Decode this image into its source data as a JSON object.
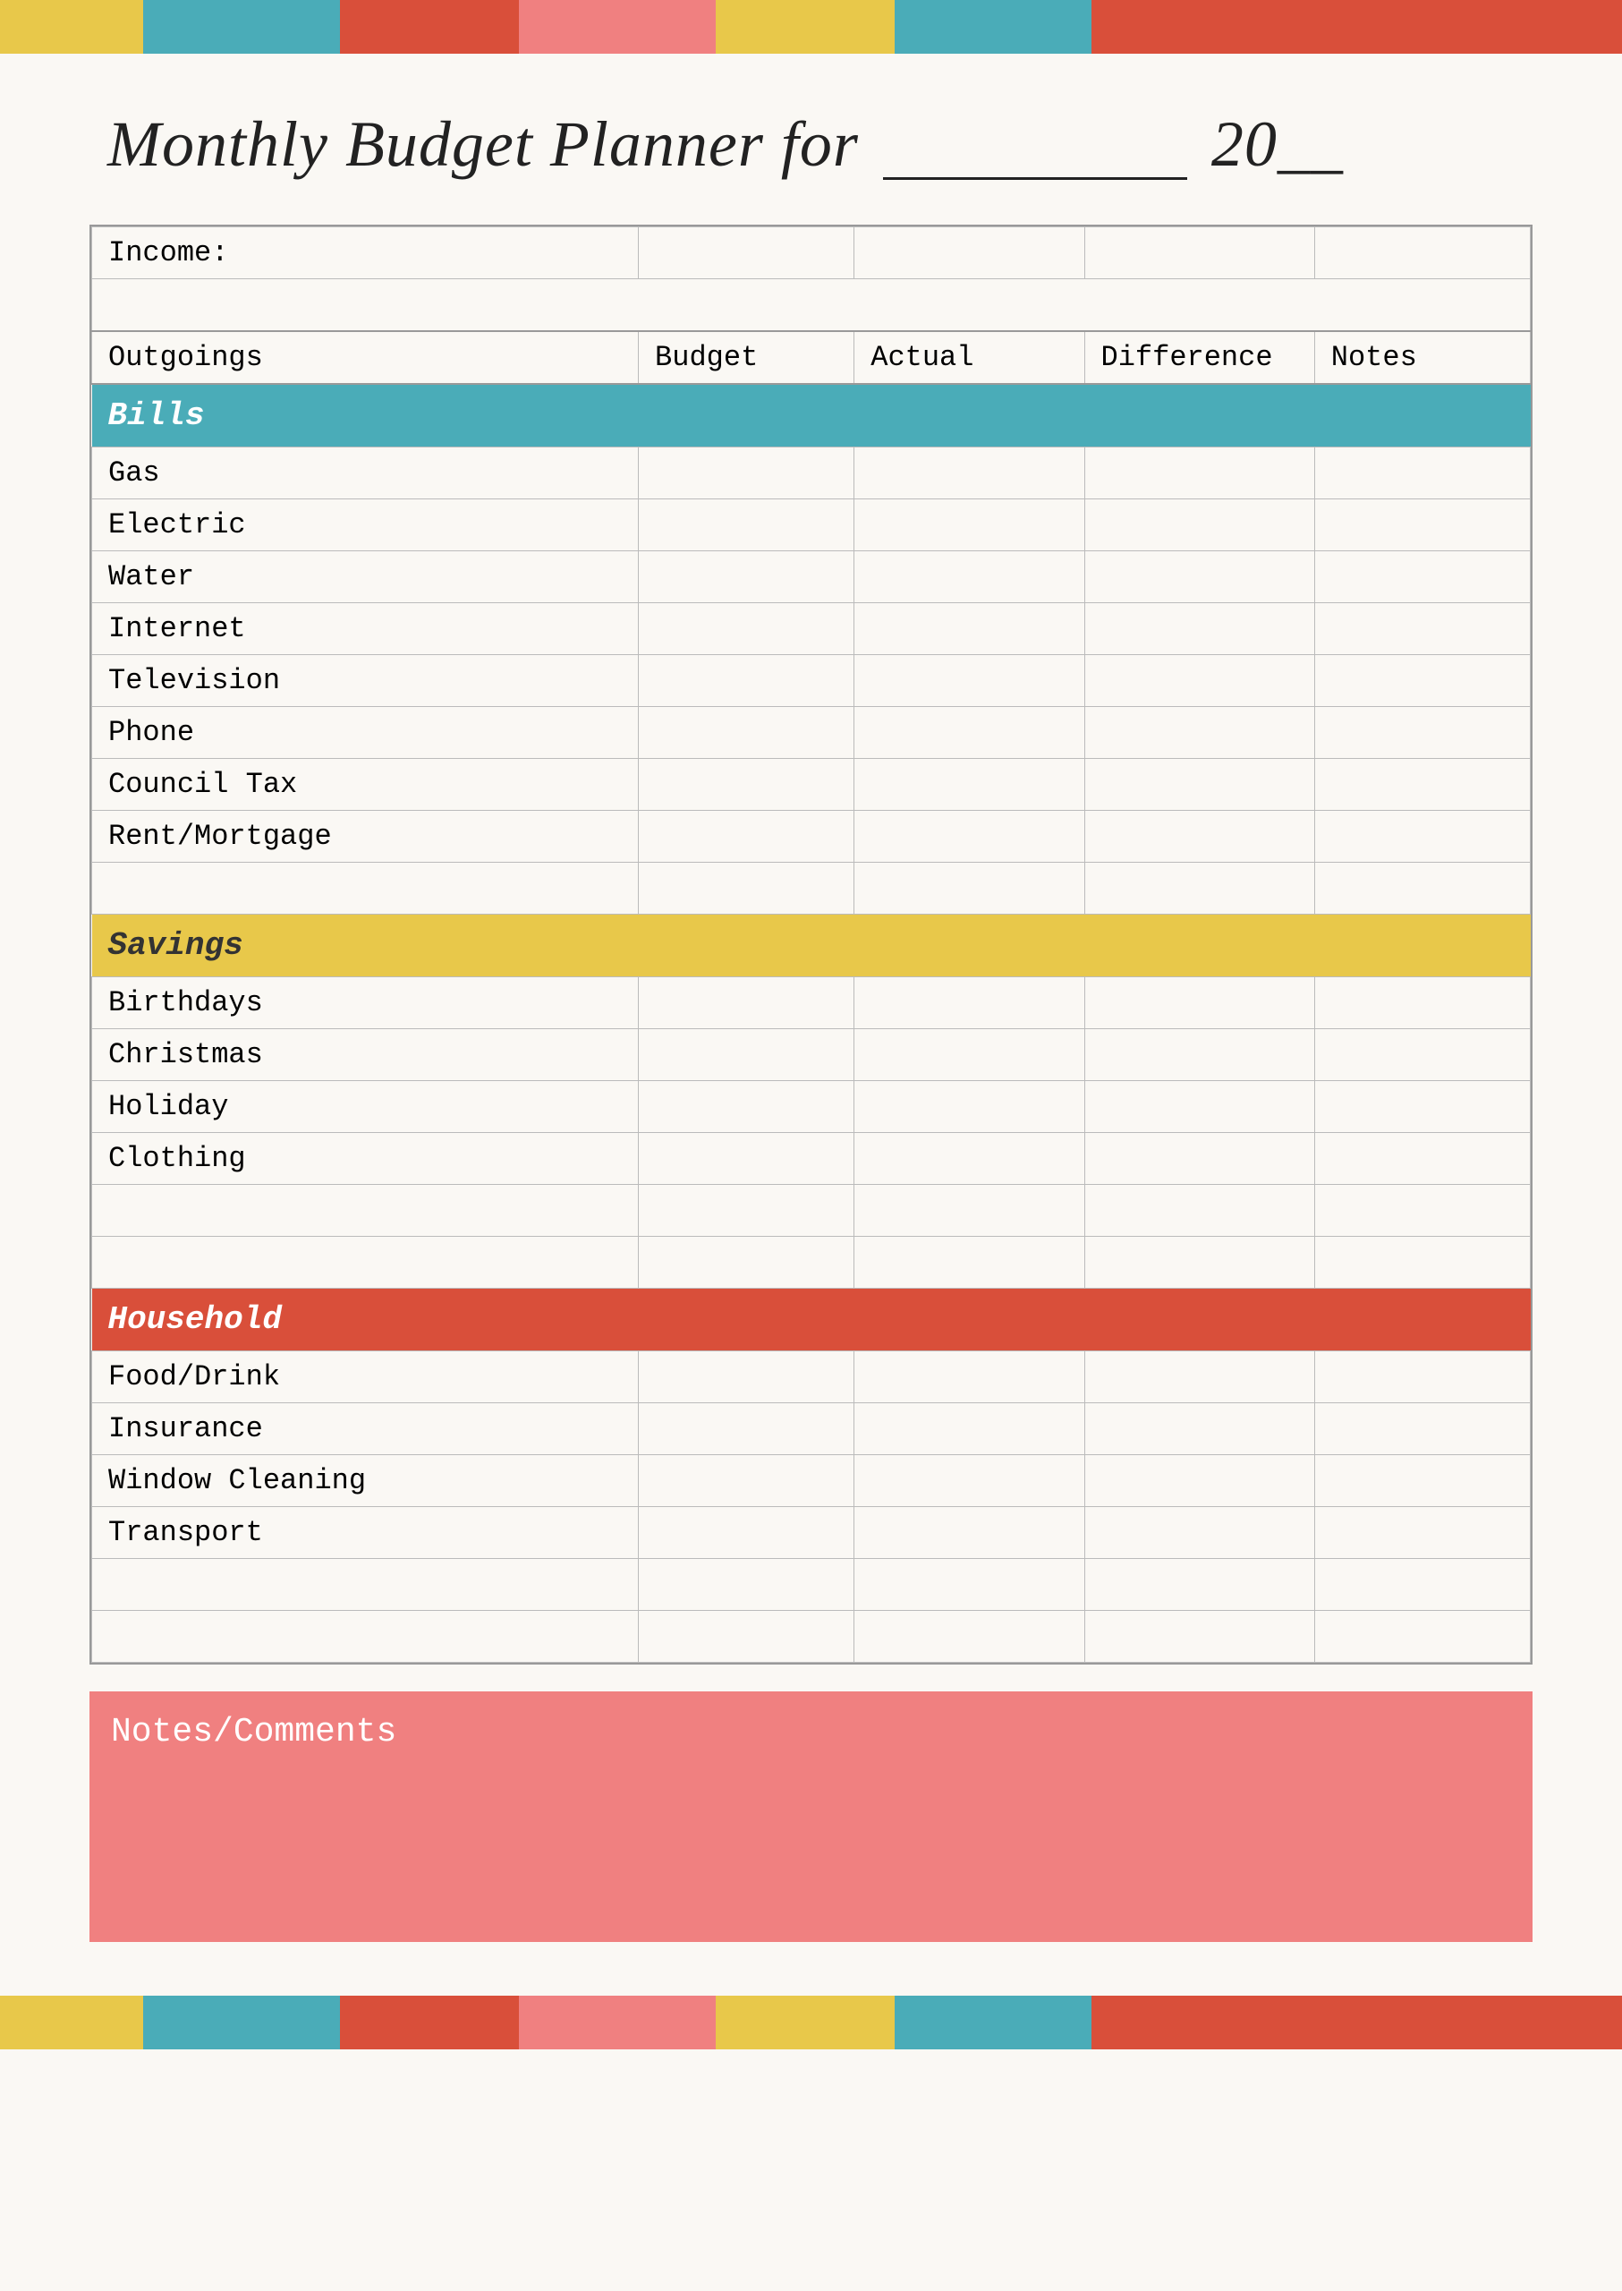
{
  "page": {
    "title": "Monthly Budget Planner for",
    "title_suffix": "20__",
    "title_line": "___________"
  },
  "colors": {
    "yellow": "#e8c84a",
    "teal": "#4aacb8",
    "red": "#d94f3a",
    "salmon": "#f08080"
  },
  "table": {
    "income_label": "Income:",
    "columns": [
      "Outgoings",
      "Budget",
      "Actual",
      "Difference",
      "Notes"
    ],
    "sections": [
      {
        "name": "Bills",
        "color": "teal",
        "rows": [
          "Gas",
          "Electric",
          "Water",
          "Internet",
          "Television",
          "Phone",
          "Council Tax",
          "Rent/Mortgage",
          ""
        ]
      },
      {
        "name": "Savings",
        "color": "yellow",
        "rows": [
          "Birthdays",
          "Christmas",
          "Holiday",
          "Clothing",
          "",
          ""
        ]
      },
      {
        "name": "Household",
        "color": "red",
        "rows": [
          "Food/Drink",
          "Insurance",
          "Window Cleaning",
          "Transport",
          "",
          ""
        ]
      }
    ]
  },
  "notes": {
    "label": "Notes/Comments"
  }
}
